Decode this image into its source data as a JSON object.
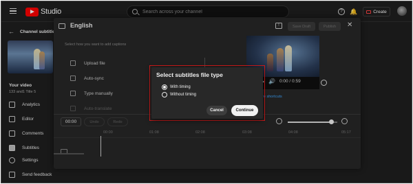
{
  "topbar": {
    "logo_text": "Studio",
    "search_placeholder": "Search across your channel",
    "create_label": "Create"
  },
  "sidebar": {
    "back_title": "Channel subtitles",
    "video_heading": "Your video",
    "video_subtitle": "133 and1 Title 5",
    "items": [
      {
        "label": "Analytics",
        "icon": "analytics-icon"
      },
      {
        "label": "Editor",
        "icon": "editor-icon"
      },
      {
        "label": "Comments",
        "icon": "comments-icon"
      },
      {
        "label": "Subtitles",
        "icon": "subtitles-icon",
        "active": true
      },
      {
        "label": "Settings",
        "icon": "settings-icon"
      },
      {
        "label": "Send feedback",
        "icon": "feedback-icon"
      }
    ]
  },
  "editor": {
    "title": "English",
    "save_draft_label": "Save Draft",
    "publish_label": "Publish",
    "hint": "Select how you want to add captions",
    "options": [
      {
        "label": "Upload file",
        "icon": "upload-icon"
      },
      {
        "label": "Auto-sync",
        "icon": "sync-icon"
      },
      {
        "label": "Type manually",
        "icon": "keyboard-icon"
      },
      {
        "label": "Auto-translate",
        "icon": "translate-icon",
        "disabled": true
      }
    ],
    "player": {
      "time": "0:00 / 0:59",
      "link_text": "ore shortcuts"
    },
    "timeline": {
      "current_time": "00:00",
      "undo_label": "Undo",
      "redo_label": "Redo",
      "zoom_level": 0.88,
      "ticks": [
        "00:00",
        "01:08",
        "02:08",
        "03:08",
        "04:08",
        "05:17"
      ]
    }
  },
  "modal": {
    "title": "Select subtitles file type",
    "options": [
      {
        "label": "With timing",
        "checked": true
      },
      {
        "label": "Without timing",
        "checked": false
      }
    ],
    "cancel_label": "Cancel",
    "continue_label": "Continue"
  },
  "colors": {
    "background": "#1f1f1f",
    "panel": "#282828",
    "highlight_outline": "#d11a1a",
    "link": "#3ea6ff",
    "brand_red": "#ff0000"
  }
}
